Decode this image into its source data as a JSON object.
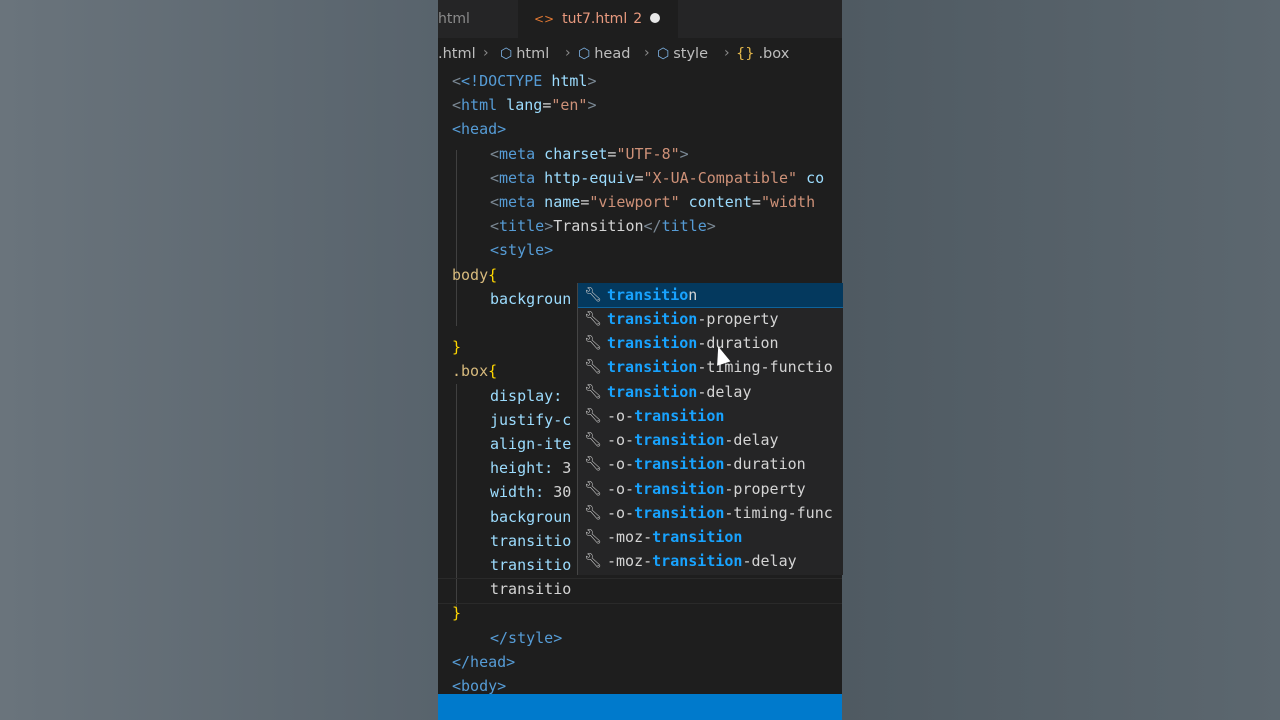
{
  "tabs": {
    "inactive_label": "html",
    "active_label": "tut7.html",
    "active_problems": "2"
  },
  "breadcrumb": [
    ".html",
    "html",
    "head",
    "style",
    ".box"
  ],
  "code_lines": {
    "l1_doctype": "<!DOCTYPE",
    "l1_html": " html",
    "l1_close": ">",
    "l2_open": "<",
    "l2_tag": "html",
    "l2_attr": " lang",
    "l2_eq": "=",
    "l2_val": "\"en\"",
    "l2_close": ">",
    "l3": "<head>",
    "l4_tag": "meta",
    "l4_attr": " charset",
    "l4_val": "\"UTF-8\"",
    "l5_tag": "meta",
    "l5_attr": " http-equiv",
    "l5_val": "\"X-UA-Compatible\"",
    "l5_more": " co",
    "l6_tag": "meta",
    "l6_attr": " name",
    "l6_val": "\"viewport\"",
    "l6_attr2": " content",
    "l6_val2": "\"width",
    "l7_title_text": "Transition",
    "l8": "<style>",
    "l9_sel": "body",
    "l9_brace": "{",
    "l10": "backgroun",
    "l12": "}",
    "l13_sel": ".box",
    "l13_brace": "{",
    "l14": "display:",
    "l15": "justify-c",
    "l16": "align-ite",
    "l17_prop": "height:",
    "l17_val": " 3",
    "l18_prop": "width:",
    "l18_val": " 30",
    "l19": "backgroun",
    "l20": "transitio",
    "l21": "transitio",
    "l22": "transitio",
    "l23": "}",
    "l24": "</style>",
    "l25": "</head>",
    "l26": "<body>"
  },
  "suggestions": [
    {
      "pre": "",
      "match": "transitio",
      "post": "n"
    },
    {
      "pre": "",
      "match": "transition",
      "post": "-property"
    },
    {
      "pre": "",
      "match": "transition",
      "post": "-duration"
    },
    {
      "pre": "",
      "match": "transition",
      "post": "-timing-functio"
    },
    {
      "pre": "",
      "match": "transition",
      "post": "-delay"
    },
    {
      "pre": "-o-",
      "match": "transition",
      "post": ""
    },
    {
      "pre": "-o-",
      "match": "transition",
      "post": "-delay"
    },
    {
      "pre": "-o-",
      "match": "transition",
      "post": "-duration"
    },
    {
      "pre": "-o-",
      "match": "transition",
      "post": "-property"
    },
    {
      "pre": "-o-",
      "match": "transition",
      "post": "-timing-func"
    },
    {
      "pre": "-moz-",
      "match": "transition",
      "post": ""
    },
    {
      "pre": "-moz-",
      "match": "transition",
      "post": "-delay"
    }
  ],
  "colors": {
    "accent": "#007acc",
    "match_highlight": "#18a3ff",
    "selected_bg": "#04395e"
  }
}
